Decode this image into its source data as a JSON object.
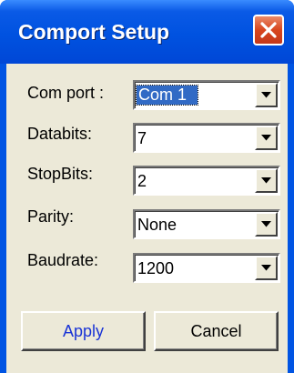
{
  "window": {
    "title": "Comport Setup"
  },
  "fields": [
    {
      "label": "Com port :",
      "value": "Com 1"
    },
    {
      "label": "Databits:",
      "value": "7"
    },
    {
      "label": "StopBits:",
      "value": "2"
    },
    {
      "label": "Parity:",
      "value": "None"
    },
    {
      "label": "Baudrate:",
      "value": "1200"
    }
  ],
  "buttons": {
    "apply_label": "Apply",
    "cancel_label": "Cancel"
  },
  "colors": {
    "titlebar": "#0054e3",
    "client_background": "#ece9d8",
    "selection": "#316ac5",
    "apply_text": "#1a34d6",
    "close_button": "#d8461e"
  },
  "icons": {
    "close": "close-icon",
    "dropdown": "chevron-down-icon"
  }
}
